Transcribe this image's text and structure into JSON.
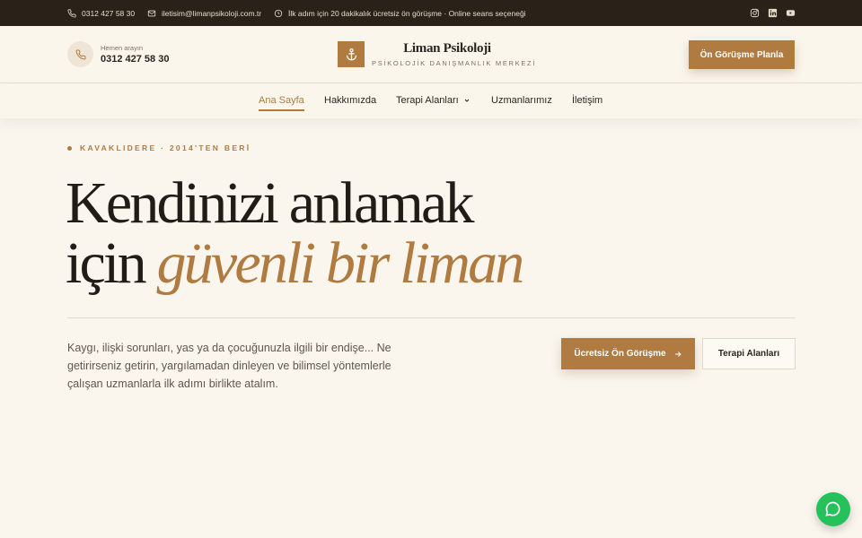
{
  "topbar": {
    "phone": "0312 427 58 30",
    "email": "iletisim@limanpsikoloji.com.tr",
    "note": "İlk adım için 20 dakikalık ücretsiz ön görüşme · Online seans seçeneği",
    "icons": [
      "phone-icon",
      "mail-icon",
      "clock-icon",
      "instagram-icon",
      "linkedin-icon",
      "youtube-icon"
    ]
  },
  "header": {
    "call_label": "Hemen arayın",
    "call_number": "0312 427 58 30",
    "logo_title": "Liman Psikoloji",
    "logo_subtitle": "PSİKOLOJİK DANIŞMANLIK MERKEZİ",
    "logo_icon": "anchor-icon",
    "cta_label": "Ön Görüşme Planla"
  },
  "nav": {
    "items": [
      {
        "label": "Ana Sayfa",
        "active": true
      },
      {
        "label": "Hakkımızda",
        "active": false
      },
      {
        "label": "Terapi Alanları",
        "active": false,
        "dropdown": true
      },
      {
        "label": "Uzmanlarımız",
        "active": false
      },
      {
        "label": "İletişim",
        "active": false
      }
    ]
  },
  "hero": {
    "eyebrow": "KAVAKLIDERE · 2014'TEN BERİ",
    "headline_line1": "Kendinizi anlamak",
    "headline_line2_plain": "için ",
    "headline_line2_accent": "güvenli bir liman",
    "lead": "Kaygı, ilişki sorunları, yas ya da çocuğunuzla ilgili bir endişe... Ne getirirseniz getirin, yargılamadan dinleyen ve bilimsel yöntemlerle çalışan uzmanlarla ilk adımı birlikte atalım.",
    "primary_cta": "Ücretsiz Ön Görüşme",
    "secondary_cta": "Terapi Alanları"
  },
  "chat": {
    "icon": "chat-icon"
  },
  "colors": {
    "accent": "#b07b40",
    "topbar_bg": "#2a2119",
    "page_bg": "#faf6ee",
    "chat_green": "#25c15a"
  }
}
